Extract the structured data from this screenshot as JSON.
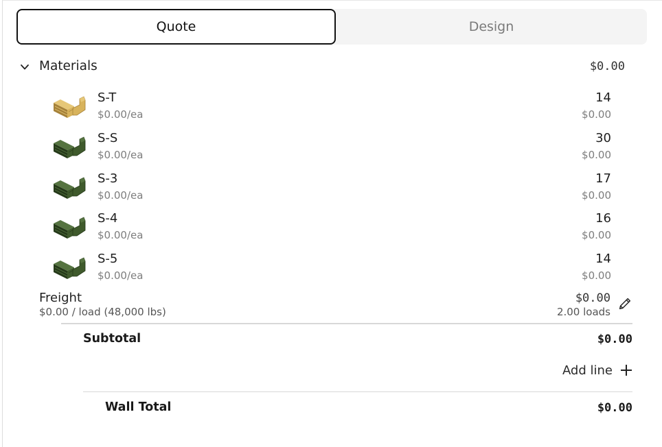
{
  "tabs": [
    {
      "label": "Quote",
      "active": true
    },
    {
      "label": "Design",
      "active": false
    }
  ],
  "materials": {
    "title": "Materials",
    "total": "$0.00",
    "expand_icon": "chevron-down-icon",
    "items": [
      {
        "name": "S-T",
        "price": "$0.00/ea",
        "qty": "14",
        "amount": "$0.00",
        "color": "#d8b35c"
      },
      {
        "name": "S-S",
        "price": "$0.00/ea",
        "qty": "30",
        "amount": "$0.00",
        "color": "#3f5a2c"
      },
      {
        "name": "S-3",
        "price": "$0.00/ea",
        "qty": "17",
        "amount": "$0.00",
        "color": "#3f5a2c"
      },
      {
        "name": "S-4",
        "price": "$0.00/ea",
        "qty": "16",
        "amount": "$0.00",
        "color": "#3f5a2c"
      },
      {
        "name": "S-5",
        "price": "$0.00/ea",
        "qty": "14",
        "amount": "$0.00",
        "color": "#3f5a2c"
      }
    ]
  },
  "freight": {
    "name": "Freight",
    "rate": "$0.00 / load (48,000 lbs)",
    "amount": "$0.00",
    "loads": "2.00 loads",
    "edit_icon": "pencil-icon"
  },
  "subtotal": {
    "label": "Subtotal",
    "value": "$0.00"
  },
  "add_line": {
    "label": "Add line",
    "icon": "plus-icon"
  },
  "wall_total": {
    "label": "Wall Total",
    "value": "$0.00"
  }
}
